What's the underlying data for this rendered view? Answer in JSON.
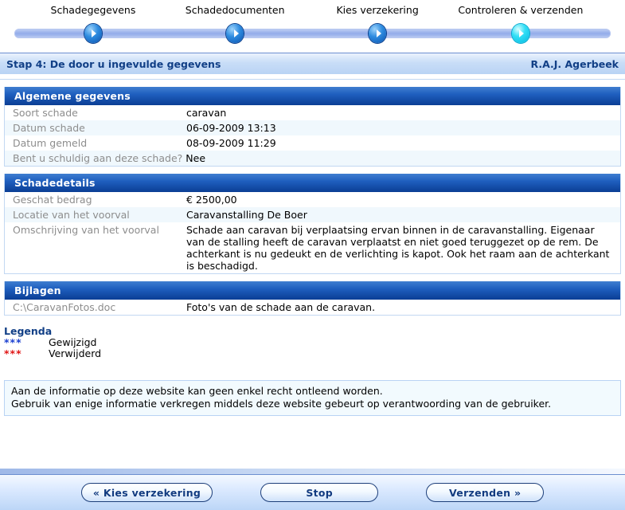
{
  "wizard": {
    "steps": [
      {
        "label": "Schadegegevens",
        "state": "done",
        "x_pct": 14.9
      },
      {
        "label": "Schadedocumenten",
        "state": "done",
        "x_pct": 37.6
      },
      {
        "label": "Kies verzekering",
        "state": "done",
        "x_pct": 60.4
      },
      {
        "label": "Controleren & verzenden",
        "state": "current",
        "x_pct": 83.3
      }
    ]
  },
  "stepbar": {
    "title": "Stap 4: De door u ingevulde gegevens",
    "user": "R.A.J. Agerbeek"
  },
  "panels": [
    {
      "title": "Algemene gegevens",
      "rows": [
        {
          "label": "Soort schade",
          "value": "caravan",
          "label_auto": false
        },
        {
          "label": "Datum schade",
          "value": "06-09-2009 13:13",
          "label_auto": false
        },
        {
          "label": "Datum gemeld",
          "value": "08-09-2009 11:29",
          "label_auto": false
        },
        {
          "label": "Bent u schuldig aan deze schade?",
          "value": "Nee",
          "label_auto": true
        }
      ]
    },
    {
      "title": "Schadedetails",
      "rows": [
        {
          "label": "Geschat bedrag",
          "value": "€ 2500,00",
          "label_auto": false
        },
        {
          "label": "Locatie van het voorval",
          "value": "Caravanstalling De Boer",
          "label_auto": false
        },
        {
          "label": "Omschrijving van het voorval",
          "value": "Schade aan caravan bij verplaatsing ervan binnen in de caravanstalling. Eigenaar van de stalling heeft de caravan verplaatst en niet goed teruggezet op de rem. De achterkant is nu gedeukt en de verlichting is kapot. Ook het raam aan de achterkant is beschadigd.",
          "label_auto": false
        }
      ]
    },
    {
      "title": "Bijlagen",
      "rows": [
        {
          "label": "C:\\CaravanFotos.doc",
          "value": "Foto's van de schade aan de caravan.",
          "label_auto": false
        }
      ]
    }
  ],
  "legenda": {
    "title": "Legenda",
    "items": [
      {
        "mark": "***",
        "text": "Gewijzigd",
        "color": "#1a3fd0",
        "kind": "changed"
      },
      {
        "mark": "***",
        "text": "Verwijderd",
        "color": "#e01414",
        "kind": "removed"
      }
    ]
  },
  "disclaimer": {
    "line1": "Aan de informatie op deze website kan geen enkel recht ontleend worden.",
    "line2": "Gebruik van enige informatie verkregen middels deze website gebeurt op verantwoording van de gebruiker."
  },
  "footer": {
    "buttons": [
      {
        "label": "« Kies verzekering",
        "name": "back-button"
      },
      {
        "label": "Stop",
        "name": "stop-button"
      },
      {
        "label": "Verzenden »",
        "name": "submit-button"
      }
    ]
  },
  "colors": {
    "accent_navy": "#0b3e94",
    "step_text": "#113f86",
    "label_gray": "#8d8d8d",
    "changed": "#1a3fd0",
    "removed": "#e01414"
  }
}
